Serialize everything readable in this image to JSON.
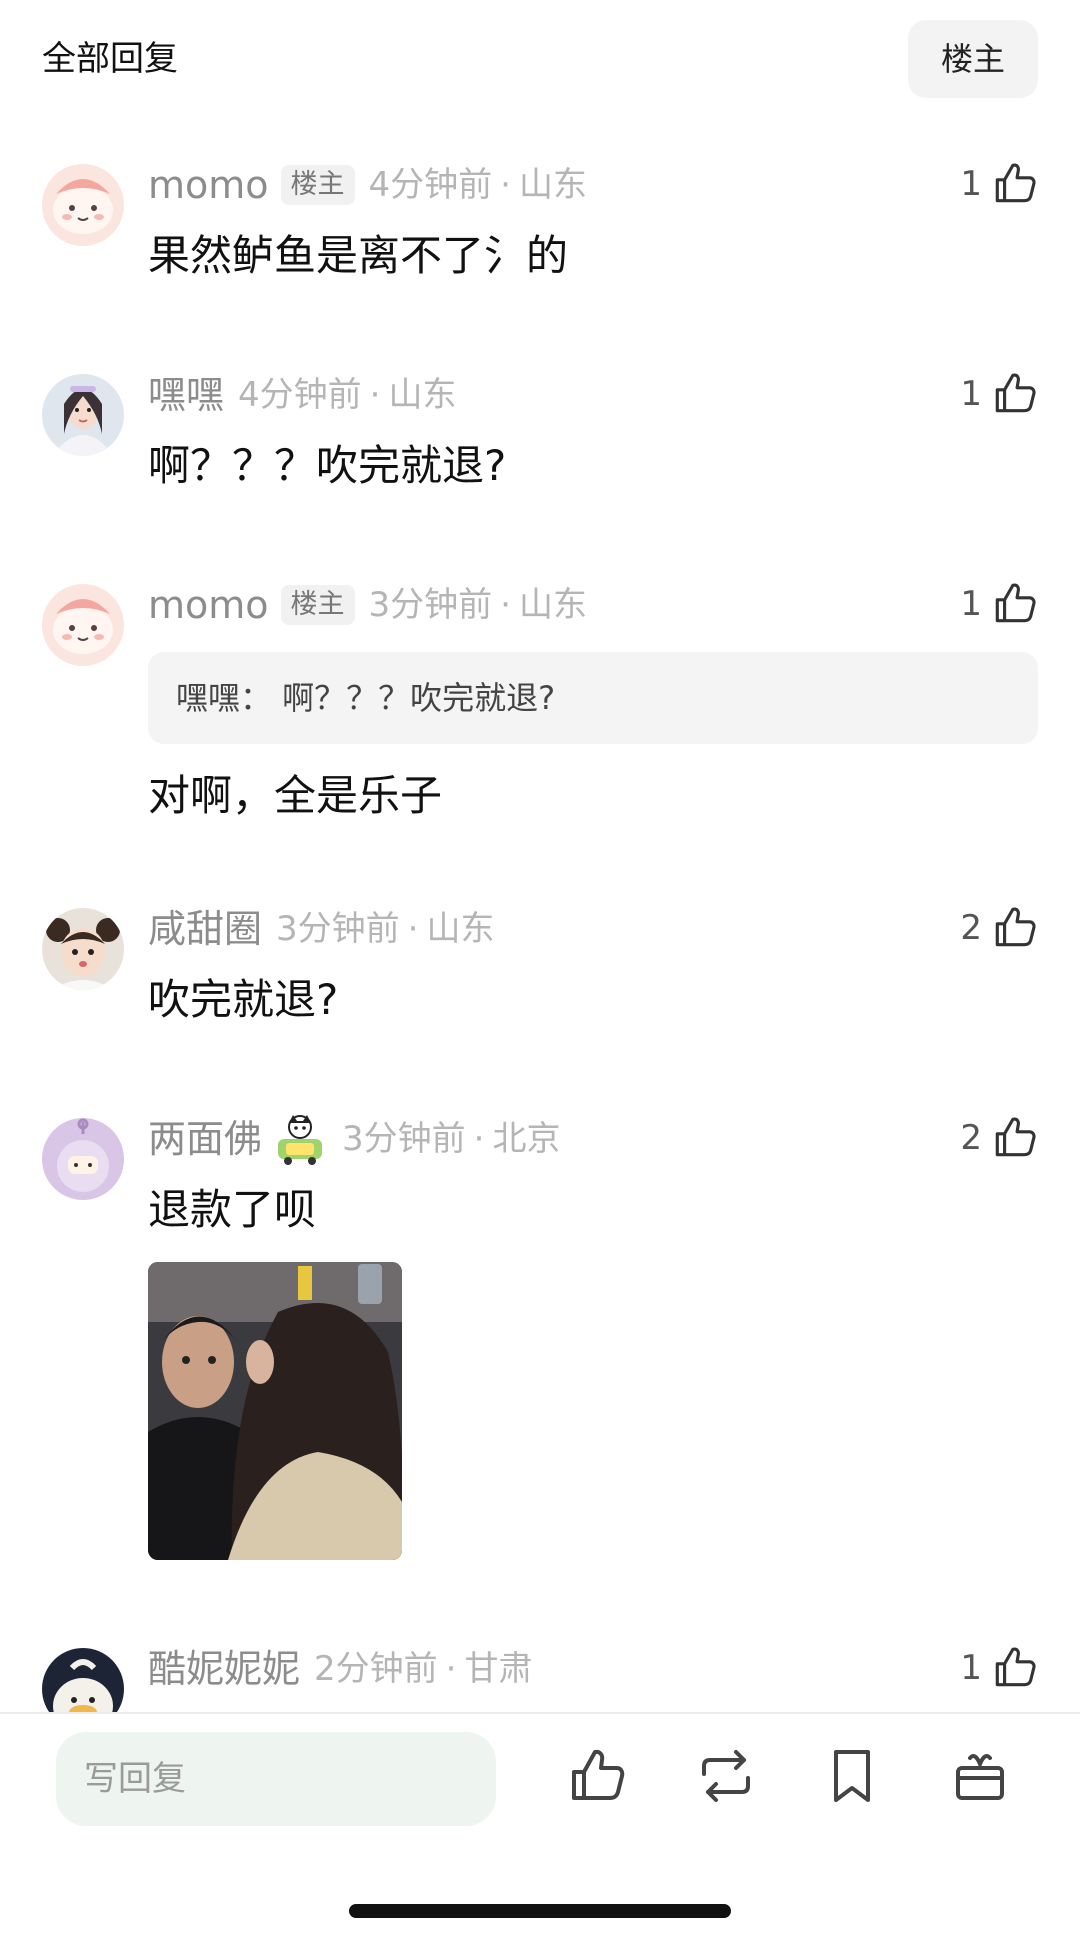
{
  "header": {
    "title": "全部回复",
    "filter_label": "楼主"
  },
  "comments": [
    {
      "username": "momo",
      "badge": "楼主",
      "time": "4分钟前",
      "location": "山东",
      "likes": "1",
      "text": "果然鲈鱼是离不了氵的"
    },
    {
      "username": "嘿嘿",
      "time": "4分钟前",
      "location": "山东",
      "likes": "1",
      "text": "啊？？？吹完就退?"
    },
    {
      "username": "momo",
      "badge": "楼主",
      "time": "3分钟前",
      "location": "山东",
      "likes": "1",
      "quote": "嘿嘿： 啊？？？吹完就退?",
      "text": "对啊，全是乐子"
    },
    {
      "username": "咸甜圈",
      "time": "3分钟前",
      "location": "山东",
      "likes": "2",
      "text": "吹完就退?"
    },
    {
      "username": "两面佛",
      "time": "3分钟前",
      "location": "北京",
      "likes": "2",
      "text": "退款了呗"
    },
    {
      "username": "酷妮妮妮",
      "time": "2分钟前",
      "location": "甘肃",
      "likes": "1"
    }
  ],
  "separator": "·",
  "bottom_bar": {
    "reply_placeholder": "写回复"
  },
  "icons": [
    "like-icon",
    "repost-icon",
    "bookmark-icon",
    "gift-icon"
  ]
}
